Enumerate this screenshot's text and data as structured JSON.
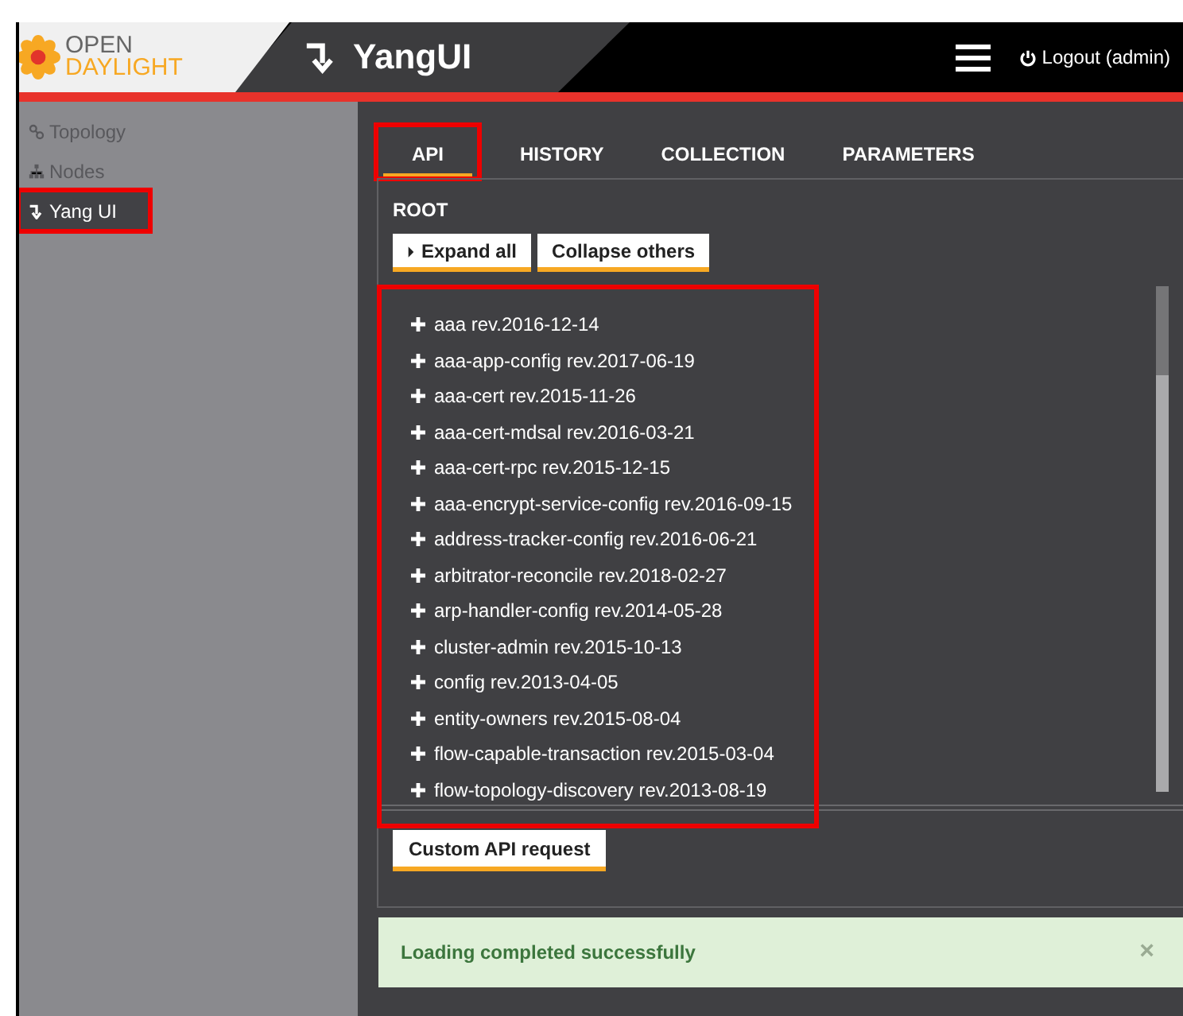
{
  "header": {
    "logo_top": "OPEN",
    "logo_bottom": "DAYLIGHT",
    "title": "YangUI",
    "logout": "Logout (admin)"
  },
  "sidebar": {
    "items": [
      {
        "label": "Topology",
        "kind": "topology",
        "selected": false,
        "highlighted": false
      },
      {
        "label": "Nodes",
        "kind": "nodes",
        "selected": false,
        "highlighted": false
      },
      {
        "label": "Yang UI",
        "kind": "yang",
        "selected": true,
        "highlighted": true
      }
    ]
  },
  "tabs": [
    {
      "label": "API",
      "selected": true,
      "highlighted": true
    },
    {
      "label": "HISTORY",
      "selected": false,
      "highlighted": false
    },
    {
      "label": "COLLECTION",
      "selected": false,
      "highlighted": false
    },
    {
      "label": "PARAMETERS",
      "selected": false,
      "highlighted": false
    }
  ],
  "panel": {
    "title": "ROOT",
    "buttons": [
      {
        "label": "Expand all",
        "kind": "caret"
      },
      {
        "label": "Collapse others",
        "kind": "plain"
      }
    ],
    "modules_highlighted": true,
    "modules": [
      "aaa rev.2016-12-14",
      "aaa-app-config rev.2017-06-19",
      "aaa-cert rev.2015-11-26",
      "aaa-cert-mdsal rev.2016-03-21",
      "aaa-cert-rpc rev.2015-12-15",
      "aaa-encrypt-service-config rev.2016-09-15",
      "address-tracker-config rev.2016-06-21",
      "arbitrator-reconcile rev.2018-02-27",
      "arp-handler-config rev.2014-05-28",
      "cluster-admin rev.2015-10-13",
      "config rev.2013-04-05",
      "entity-owners rev.2015-08-04",
      "flow-capable-transaction rev.2015-03-04",
      "flow-topology-discovery rev.2013-08-19"
    ],
    "custom_button": "Custom API request"
  },
  "alert": {
    "message": "Loading completed successfully",
    "close": "×"
  }
}
